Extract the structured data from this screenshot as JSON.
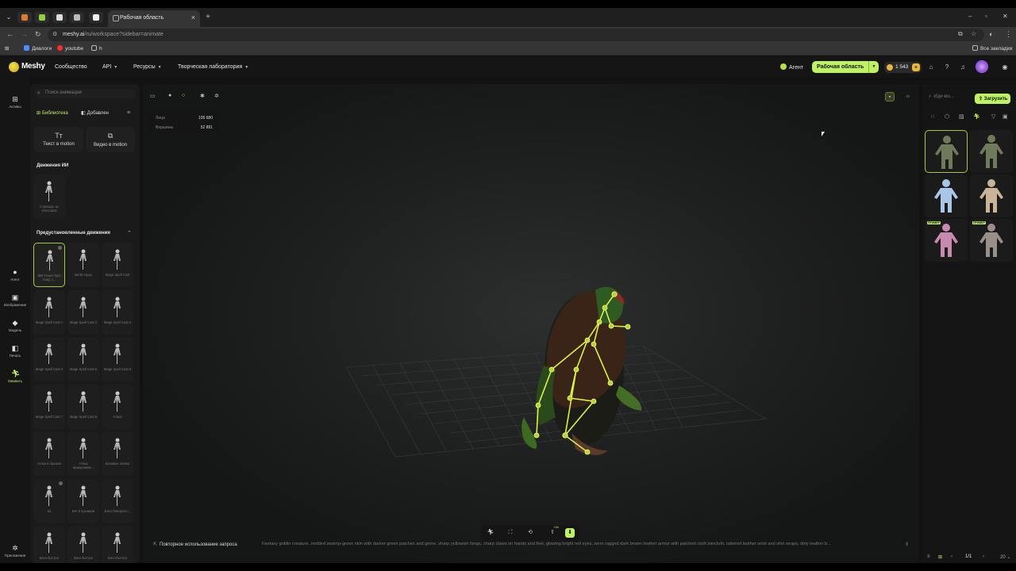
{
  "browser": {
    "tab_title": "Рабочая область",
    "url_host": "meshy.ai",
    "url_path": "/ru/workspace?sidebar=animate",
    "bookmarks": [
      "Диалоги",
      "youtube",
      "h"
    ],
    "all_bookmarks": "Все закладки"
  },
  "header": {
    "logo": "Meshy",
    "nav": [
      "Сообщество",
      "API",
      "Ресурсы",
      "Творческая лаборатория"
    ],
    "agent": "Агент",
    "workspace": "Рабочая область",
    "credits": "1 543"
  },
  "rail": {
    "assets": "Активы",
    "items": [
      "Агент",
      "Изображение",
      "Модель",
      "Печать",
      "Оживить"
    ],
    "bottom": "Приложения"
  },
  "library": {
    "search_placeholder": "Поиск анимации",
    "tabs": [
      "Библиотека",
      "Добавлен"
    ],
    "modes": [
      "Текст в motion",
      "Видео в motion"
    ],
    "ai_section": "Движения ИИ",
    "ai_item": "Стриндзь из текстовов",
    "preset_section": "Предустановленные движения",
    "presets": [
      "360 Power Spin Jump 1...",
      "Berlin Hyup",
      "Mage Spell Cast",
      "Mage Spell Cast 1",
      "Mage Spell Cast 2",
      "Mage Spell Cast 3",
      "Mage Spell Cast 4",
      "Mage Spell Cast 5",
      "Mage Spell Cast 6",
      "Mage Spell Cast 7",
      "Mage Spell Cast 8",
      "Атака",
      "Атака в прыжке",
      "Атака вращением...",
      "Базовые литмы",
      "ad",
      "Бег в прыжков",
      "Бега Поворотн...",
      "Бега быстро",
      "Бега быстро",
      "Бега быстро"
    ]
  },
  "viewport": {
    "faces_label": "Лица",
    "faces": "105 680",
    "verts_label": "Вершины",
    "verts": "52 881",
    "badge": "+16"
  },
  "prompt": {
    "reuse": "Повторное использование запроса",
    "text": "Fantasy goblin creature, mottled swamp-green skin with darker green patches and grime, sharp yellowish fangs, sharp claws on hands and feet, glowing bright red eyes, worn ragged dark brown leather armor with patched cloth loincloth, tattered leather wrist and shin wraps, dirty leather b..."
  },
  "right": {
    "search_placeholder": "Иди мо...",
    "upload": "Загрузить",
    "badge": "ПРИМЕР",
    "page": "1/1",
    "per_page": "20"
  },
  "colors": {
    "accent": "#bef264",
    "bg": "#121212",
    "skeleton": "#d9f24a"
  }
}
